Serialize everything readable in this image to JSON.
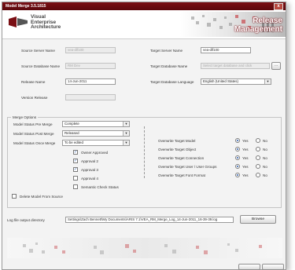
{
  "window": {
    "title": "Model Merge 3.5.1815",
    "close_glyph": "x"
  },
  "header": {
    "logo_lines": [
      "Visual",
      "Enterprise",
      "Architecture"
    ],
    "banner_lines": [
      "Release",
      "Management"
    ],
    "brand_color": "#7a0f14"
  },
  "fields": {
    "source_server_label": "Source Server Name",
    "source_server_value": "vea-dlf100",
    "source_db_label": "Source Database Name",
    "source_db_value": "RM Dev",
    "release_name_label": "Release Name",
    "release_name_value": "14-Jun-2011",
    "version_release_label": "Version Release",
    "version_release_value": "",
    "target_server_label": "Target Server Name",
    "target_server_value": "vea-dlf100",
    "target_db_label": "Target Database Name",
    "target_db_value": "Select target database and click",
    "target_db_btn": "...",
    "target_lang_label": "Target Database Language",
    "target_lang_value": "English (United States)"
  },
  "merge_options": {
    "group_title": "Merge Options",
    "pre_merge_label": "Model Status Pre Merge",
    "pre_merge_value": "Complete",
    "post_merge_label": "Model Status Post Merge",
    "post_merge_value": "Released",
    "once_merge_label": "Model Status Once Merge",
    "once_merge_value": "To be edited",
    "approvals": [
      {
        "label": "Owner Approved",
        "checked": true
      },
      {
        "label": "Approval 2",
        "checked": true
      },
      {
        "label": "Approval 3",
        "checked": true
      },
      {
        "label": "Approval 4",
        "checked": false
      },
      {
        "label": "Semantic Check Status",
        "checked": false
      }
    ],
    "delete_label": "Delete Model From Source",
    "overwrite_rows": [
      {
        "label": "Overwrite Target Model",
        "value": "Yes"
      },
      {
        "label": "Overwrite Target Object",
        "value": "Yes"
      },
      {
        "label": "Overwrite Target Connection",
        "value": "Yes"
      },
      {
        "label": "Overwrite Target User / User Groups",
        "value": "Yes"
      },
      {
        "label": "Overwrite Target Font Format",
        "value": "Yes"
      }
    ],
    "yes_label": "Yes",
    "no_label": "No"
  },
  "log": {
    "label": "Log file output directory",
    "value": "Settings\\Zach Bennett\\My Documents\\ARIS 7.1\\VEA_RM_Merge_Log_14-Jun-2011_16-39-39.log",
    "browse_label": "Browse"
  }
}
